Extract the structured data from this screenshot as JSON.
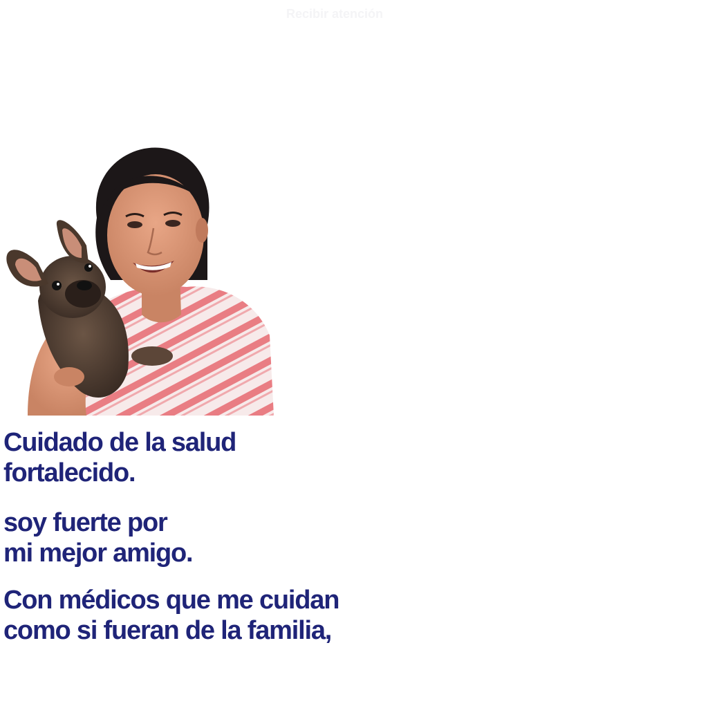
{
  "cta": {
    "label": "Recibir atención"
  },
  "hero": {
    "headline": {
      "line1": "Cuidado de la salud",
      "line2": "fortalecido."
    },
    "subline": {
      "line1": "soy fuerte por",
      "line2": "mi mejor amigo."
    },
    "body": {
      "line1": "Con médicos que me cuidan",
      "line2": "como si fueran de la familia,"
    }
  },
  "colors": {
    "text_primary": "#1f2478",
    "background": "#ffffff",
    "cta_text": "#f4f4f6",
    "shirt_stripe": "#e86f78",
    "hair": "#1c1718",
    "dog_fur": "#5a4638"
  },
  "image": {
    "subject": "woman-holding-french-bulldog-photo"
  }
}
